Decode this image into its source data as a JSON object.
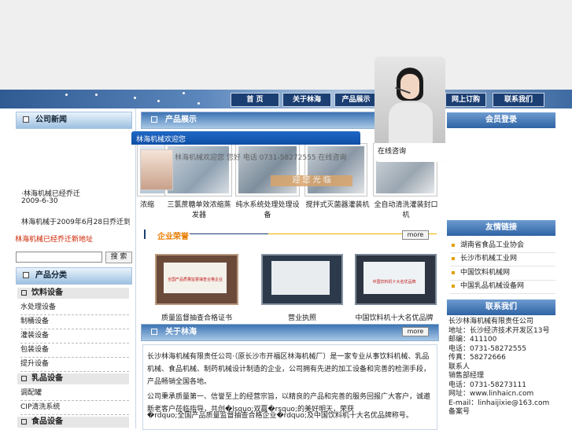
{
  "nav": {
    "items": [
      "首 页",
      "关于林海",
      "产品展示",
      "网上订购",
      "联系我们"
    ]
  },
  "left": {
    "news_title": "公司新闻",
    "news_item": "·林海机械已经乔迁",
    "news_date": "2009-6-30",
    "news_body": "林海机械于2009年6月28日乔迁到长沙经济技术",
    "news_link": "林海机械已经乔迁新地址",
    "search_button": "搜 索",
    "search_value": "",
    "products_title": "产品分类",
    "groups": [
      {
        "title": "饮料设备",
        "items": [
          "水处理设备",
          "制桶设备",
          "灌装设备",
          "包装设备",
          "提升设备"
        ]
      },
      {
        "title": "乳品设备",
        "items": [
          "调配罐",
          "CIP清洗系统"
        ]
      },
      {
        "title": "食品设备",
        "items": []
      }
    ]
  },
  "middle": {
    "showcase_title": "产品展示",
    "showcase_tab": "林海机械欢迎您",
    "overlay_text": "林海机械欢迎您 您好 电话 0731-58272555 在线咨询",
    "overlay_stamp": "迎 您 光 临",
    "showcase_captions": [
      "浓缩",
      "三氯蔗糖单效浓缩蒸发器",
      "纯水系统处理处理设备",
      "搅拌式灭菌器灌装机",
      "全自动清洗灌装封口机"
    ],
    "honor_title": "企业荣誉",
    "honor_more": "more",
    "cert_texts": [
      "全国产品质量监督抽查合格企业",
      "",
      "中国饮料机十大名优品牌"
    ],
    "honor_captions": [
      "质量监督抽查合格证书",
      "营业执照",
      "中国饮料机十大名优品牌"
    ],
    "about_title": "关于林海",
    "about_more": "more",
    "about_p1": "长沙林海机械有限责任公司·（原长沙市开福区林海机械厂）是一家专业从事饮料机械、乳品机械、食品机械、制药机械设计制造的企业，公司拥有先进的加工设备和完善的检测手段，产品畅销全国各地。",
    "about_p2": "公司秉承质量第一、信誉至上的经营宗旨，以精良的产品和完善的服务回报广大客户，诚邀新老客户莅临指导，共创�lsquo;双赢�rsquo;的美好明天，荣获",
    "about_p3": "�rdquo;全国产品质量监督抽查合格企业�rdquo;及中国饮料机十大名优品牌称号。"
  },
  "right": {
    "login_title": "会员登录",
    "links_title": "友情链接",
    "links": [
      "湖南省食品工业协会",
      "长沙市机械工业网",
      "中国饮料机械网",
      "中国乳品机械设备网"
    ],
    "contact_title": "联系我们",
    "contact_lines": [
      "长沙林海机械有限责任公司",
      "地址：长沙经济技术开发区13号",
      "邮编：411100",
      "电话：0731-58272555",
      "传真：58272666",
      "联系人",
      "销售部经理",
      "电话：0731-58273111",
      "网址：www.linhaicn.com",
      "E-mail：linhaijixie@163.com",
      "备案号"
    ]
  },
  "consult": {
    "label": "在线咨询"
  },
  "colors": {
    "nav_dark": "#1c3f73",
    "accent_orange": "#e87d00",
    "link_red": "#cc2200"
  }
}
